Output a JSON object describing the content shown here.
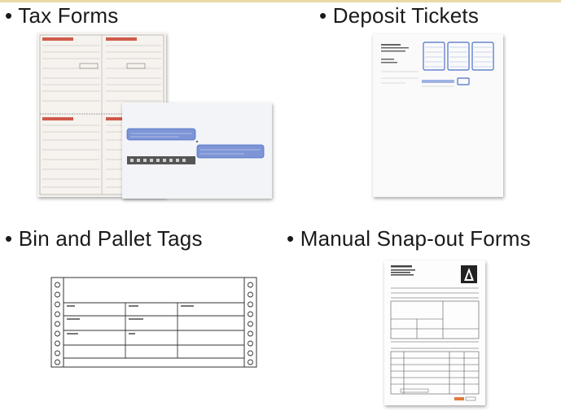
{
  "items": [
    {
      "label": "• Tax Forms"
    },
    {
      "label": "• Deposit Tickets"
    },
    {
      "label": "• Bin and Pallet Tags"
    },
    {
      "label": "• Manual Snap-out Forms"
    }
  ],
  "colors": {
    "top_bar": "#e8d9a6",
    "form_blue": "#4a6fc7",
    "form_red": "#d05a4a",
    "snapout_accent": "#e07a3a"
  }
}
